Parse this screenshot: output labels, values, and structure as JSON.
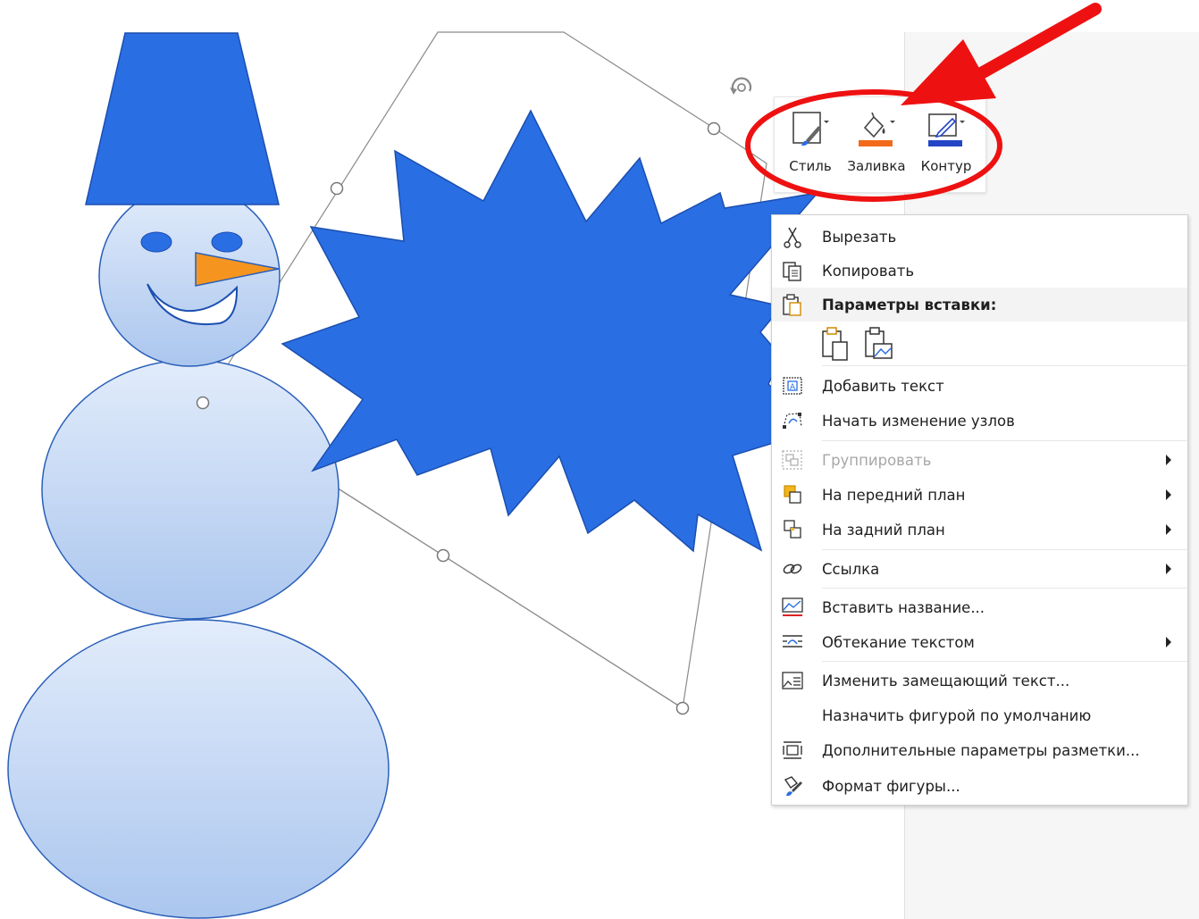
{
  "mini_toolbar": {
    "style_label": "Стиль",
    "fill_label": "Заливка",
    "outline_label": "Контур"
  },
  "context_menu": {
    "cut": "Вырезать",
    "copy": "Копировать",
    "paste_options": "Параметры вставки:",
    "add_text": "Добавить текст",
    "edit_points": "Начать изменение узлов",
    "group": "Группировать",
    "bring_to_front": "На передний план",
    "send_to_back": "На задний план",
    "link": "Ссылка",
    "insert_caption": "Вставить название...",
    "wrap_text": "Обтекание текстом",
    "edit_alt_text": "Изменить замещающий текст...",
    "set_default_shape": "Назначить фигурой по умолчанию",
    "more_layout_options": "Дополнительные параметры разметки...",
    "format_shape": "Формат фигуры..."
  },
  "colors": {
    "shape_blue": "#2a6ee3",
    "snowman_light": "#c3d6f2",
    "nose_orange": "#f5951f",
    "annotation_red": "#ee1111",
    "fill_swatch": "#f26a1b",
    "outline_swatch": "#2446c6"
  },
  "icons": {
    "cut": "scissors-icon",
    "copy": "copy-icon",
    "paste": "clipboard-icon",
    "add_text": "text-box-icon",
    "edit_points": "edit-points-icon",
    "group": "group-icon",
    "bring_to_front": "bring-forward-icon",
    "send_to_back": "send-backward-icon",
    "link": "link-icon",
    "insert_caption": "caption-icon",
    "wrap_text": "wrap-text-icon",
    "edit_alt_text": "alt-text-icon",
    "more_layout": "layout-options-icon",
    "format_shape": "format-shape-icon",
    "rotate": "rotate-icon"
  }
}
